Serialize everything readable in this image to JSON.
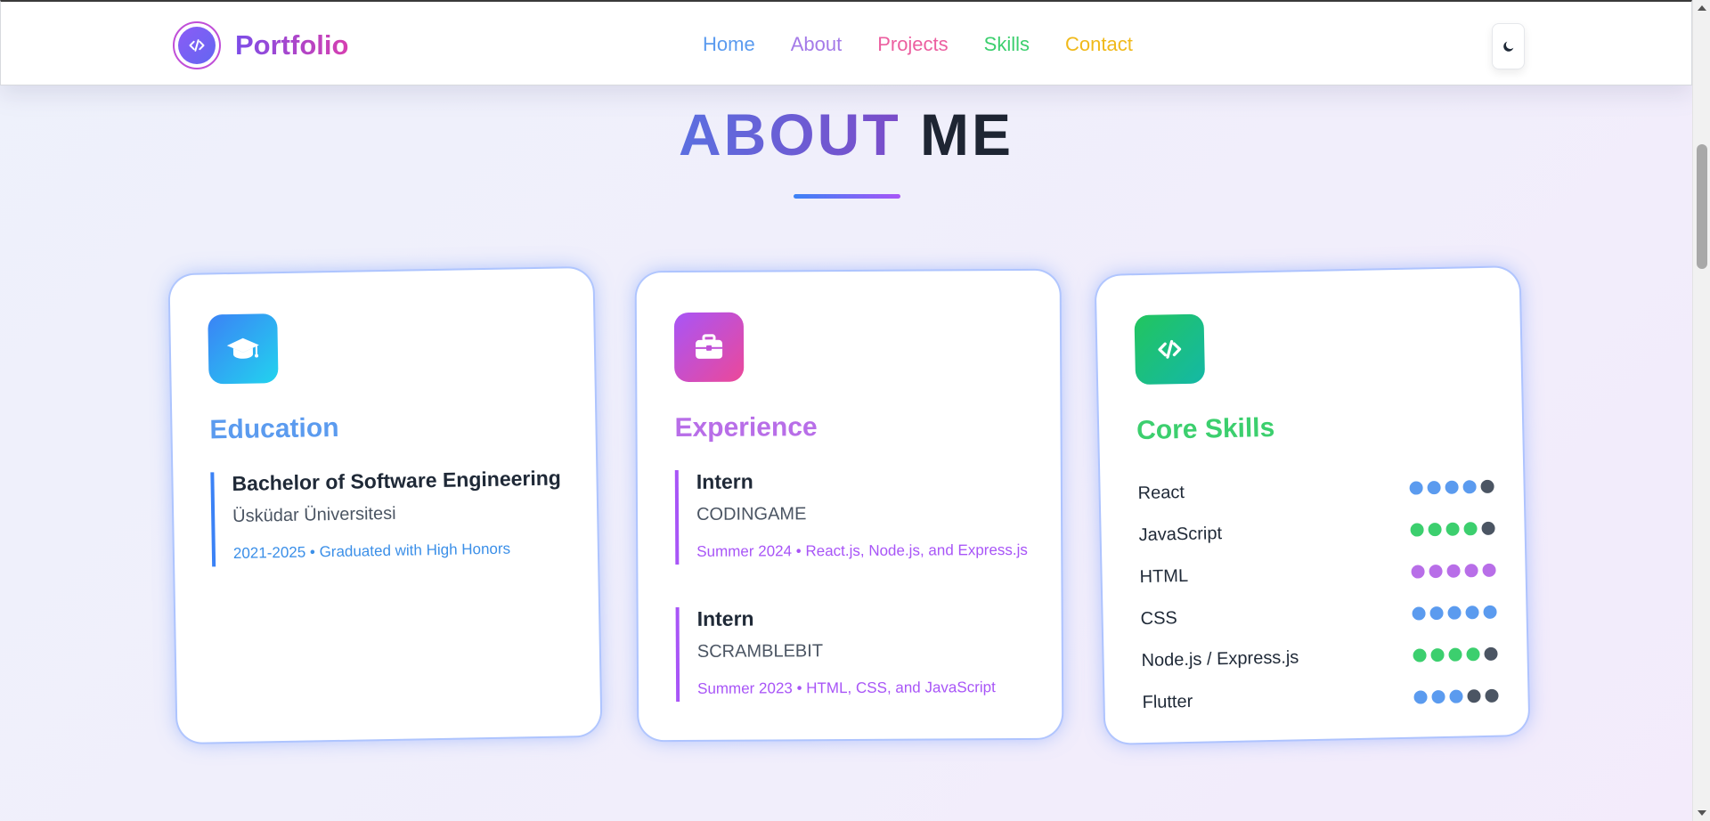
{
  "brand": {
    "name": "Portfolio",
    "logo_icon": "code-icon"
  },
  "nav": {
    "items": [
      {
        "label": "Home",
        "color": "#5b9bef"
      },
      {
        "label": "About",
        "color": "#a47ae8"
      },
      {
        "label": "Projects",
        "color": "#ec5fa0"
      },
      {
        "label": "Skills",
        "color": "#3ccf6e"
      },
      {
        "label": "Contact",
        "color": "#f0b91a"
      }
    ],
    "theme_toggle_icon": "moon-icon"
  },
  "section": {
    "title_accent": "ABOUT",
    "title_rest": "ME"
  },
  "cards": {
    "education": {
      "title": "Education",
      "title_color": "#5b9bef",
      "icon": "graduation-cap-icon",
      "entries": [
        {
          "role": "Bachelor of Software Engineering",
          "org": "Üsküdar Üniversitesi",
          "meta": "2021-2025 • Graduated with High Honors"
        }
      ]
    },
    "experience": {
      "title": "Experience",
      "title_color": "#b86ee8",
      "icon": "briefcase-icon",
      "entries": [
        {
          "role": "Intern",
          "org": "CODINGAME",
          "meta": "Summer 2024 • React.js, Node.js, and Express.js"
        },
        {
          "role": "Intern",
          "org": "SCRAMBLEBIT",
          "meta": "Summer 2023 • HTML, CSS, and JavaScript"
        }
      ]
    },
    "skills": {
      "title": "Core Skills",
      "title_color": "#3ccf6e",
      "icon": "code-icon",
      "items": [
        {
          "name": "React",
          "level": 4,
          "color": "#5b9bef"
        },
        {
          "name": "JavaScript",
          "level": 4,
          "color": "#3ccf6e"
        },
        {
          "name": "HTML",
          "level": 5,
          "color": "#b86ee8"
        },
        {
          "name": "CSS",
          "level": 5,
          "color": "#5b9bef"
        },
        {
          "name": "Node.js / Express.js",
          "level": 4,
          "color": "#3ccf6e"
        },
        {
          "name": "Flutter",
          "level": 3,
          "color": "#5b9bef"
        }
      ],
      "max_level": 5,
      "empty_color": "#4b5563"
    }
  }
}
